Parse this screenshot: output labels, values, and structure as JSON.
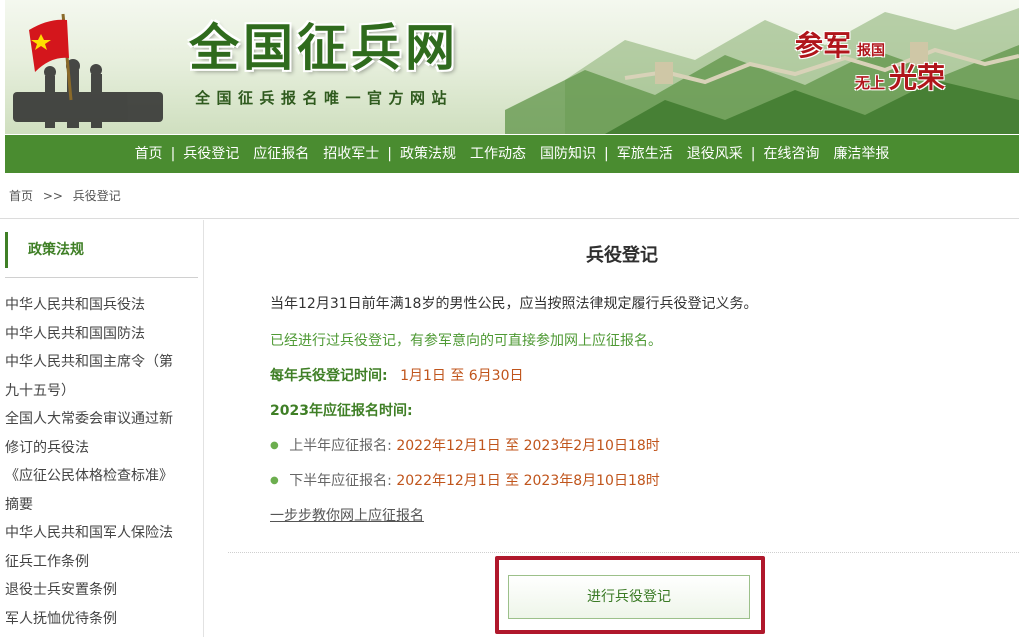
{
  "site": {
    "title": "全国征兵网",
    "subtitle": "全国征兵报名唯一官方网站",
    "slogan": {
      "part1": "参军",
      "part2": "报国",
      "part3": "无上",
      "part4": "光荣"
    }
  },
  "nav": {
    "items": [
      "首页",
      "兵役登记",
      "应征报名",
      "招收军士",
      "政策法规",
      "工作动态",
      "国防知识",
      "军旅生活",
      "退役风采",
      "在线咨询",
      "廉洁举报"
    ],
    "separator": "|"
  },
  "breadcrumb": {
    "home": "首页",
    "sep": ">>",
    "current": "兵役登记"
  },
  "sidebar": {
    "heading": "政策法规",
    "links": [
      "中华人民共和国兵役法",
      "中华人民共和国国防法",
      "中华人民共和国主席令（第",
      "九十五号）",
      "全国人大常委会审议通过新",
      "修订的兵役法",
      "《应征公民体格检查标准》",
      "摘要",
      "中华人民共和国军人保险法",
      "征兵工作条例",
      "退役士兵安置条例",
      "军人抚恤优待条例"
    ]
  },
  "main": {
    "title": "兵役登记",
    "intro": "当年12月31日前年满18岁的男性公民，应当按照法律规定履行兵役登记义务。",
    "note": "已经进行过兵役登记，有参军意向的可直接参加网上应征报名。",
    "annual": {
      "label": "每年兵役登记时间:",
      "value": "1月1日 至 6月30日"
    },
    "enlist_heading": "2023年应征报名时间:",
    "periods": [
      {
        "label": "上半年应征报名:",
        "value": "2022年12月1日 至 2023年2月10日18时"
      },
      {
        "label": "下半年应征报名:",
        "value": "2022年12月1日 至 2023年8月10日18时"
      }
    ],
    "guide_link": "一步步教你网上应征报名",
    "register_button": "进行兵役登记"
  },
  "colors": {
    "nav_green": "#4a8c30",
    "title_green": "#2f6b1d",
    "accent_orange": "#c0551c",
    "highlight_red": "#b0182c"
  }
}
